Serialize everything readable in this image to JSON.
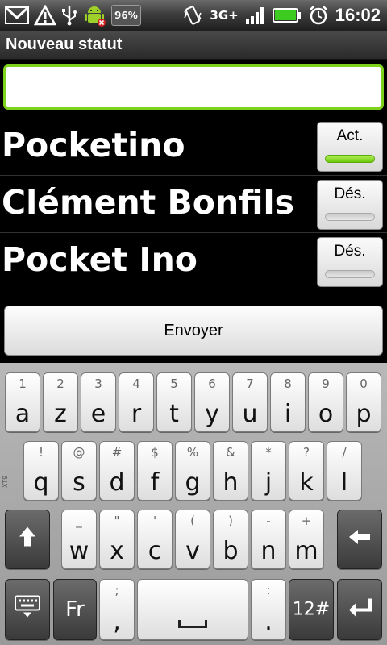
{
  "status_bar": {
    "battery_percent_badge": "96%",
    "network_type": "3G+",
    "time": "16:02",
    "icons": [
      "gmail-icon",
      "warning-icon",
      "usb-icon",
      "android-debug-icon",
      "battery-percent-icon",
      "vibrate-icon",
      "network-icon",
      "signal-icon",
      "battery-icon",
      "alarm-icon"
    ]
  },
  "title": "Nouveau statut",
  "status_input": {
    "value": "",
    "placeholder": ""
  },
  "accounts": [
    {
      "name": "Pocketino",
      "toggle_label": "Act.",
      "enabled": true
    },
    {
      "name": "Clément Bonfils",
      "toggle_label": "Dés.",
      "enabled": false
    },
    {
      "name": "Pocket Ino",
      "toggle_label": "Dés.",
      "enabled": false
    }
  ],
  "send_button": "Envoyer",
  "keyboard": {
    "side_label": "XT9",
    "row1": [
      {
        "sec": "1",
        "pri": "a"
      },
      {
        "sec": "2",
        "pri": "z"
      },
      {
        "sec": "3",
        "pri": "e"
      },
      {
        "sec": "4",
        "pri": "r"
      },
      {
        "sec": "5",
        "pri": "t"
      },
      {
        "sec": "6",
        "pri": "y"
      },
      {
        "sec": "7",
        "pri": "u"
      },
      {
        "sec": "8",
        "pri": "i"
      },
      {
        "sec": "9",
        "pri": "o"
      },
      {
        "sec": "0",
        "pri": "p"
      }
    ],
    "row2": [
      {
        "sec": "!",
        "pri": "q"
      },
      {
        "sec": "@",
        "pri": "s"
      },
      {
        "sec": "#",
        "pri": "d"
      },
      {
        "sec": "$",
        "pri": "f"
      },
      {
        "sec": "%",
        "pri": "g"
      },
      {
        "sec": "&",
        "pri": "h"
      },
      {
        "sec": "*",
        "pri": "j"
      },
      {
        "sec": "?",
        "pri": "k"
      },
      {
        "sec": "/",
        "pri": "l"
      }
    ],
    "row3": [
      {
        "sec": "_",
        "pri": "w"
      },
      {
        "sec": "\"",
        "pri": "x"
      },
      {
        "sec": "'",
        "pri": "c"
      },
      {
        "sec": "(",
        "pri": "v"
      },
      {
        "sec": ")",
        "pri": "b"
      },
      {
        "sec": "-",
        "pri": "n"
      },
      {
        "sec": "+",
        "pri": "m"
      }
    ],
    "row4": {
      "lang": "Fr",
      "punct_top": ",",
      "punct_bottom": ";",
      "colon_top": ":",
      "colon_bottom": ".",
      "symbols": "12#"
    }
  }
}
